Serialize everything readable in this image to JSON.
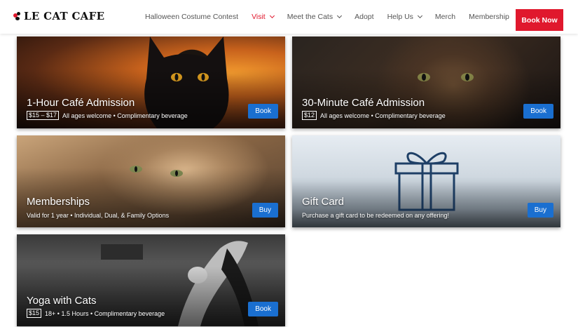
{
  "brand": {
    "name": "LE CAT CAFE",
    "accent": "#e0182d",
    "button_blue": "#1a6fd0"
  },
  "nav": {
    "items": [
      {
        "label": "Halloween Costume Contest",
        "dropdown": false,
        "active": false
      },
      {
        "label": "Visit",
        "dropdown": true,
        "active": true
      },
      {
        "label": "Meet the Cats",
        "dropdown": true,
        "active": false
      },
      {
        "label": "Adopt",
        "dropdown": false,
        "active": false
      },
      {
        "label": "Help Us",
        "dropdown": true,
        "active": false
      },
      {
        "label": "Merch",
        "dropdown": false,
        "active": false
      },
      {
        "label": "Membership",
        "dropdown": false,
        "active": false
      }
    ],
    "cta": "Book Now"
  },
  "cards": [
    {
      "title": "1-Hour Café Admission",
      "price": "$15 – $17",
      "subtitle": "All ages welcome • Complimentary beverage",
      "button": "Book",
      "image": "black-cat-photo"
    },
    {
      "title": "30-Minute Café Admission",
      "price": "$12",
      "subtitle": "All ages welcome • Complimentary beverage",
      "button": "Book",
      "image": "tabby-cat-photo"
    },
    {
      "title": "Memberships",
      "price": "",
      "subtitle": "Valid for 1 year • Individual, Dual, & Family Options",
      "button": "Buy",
      "image": "lounging-cat-photo"
    },
    {
      "title": "Gift Card",
      "price": "",
      "subtitle": "Purchase a gift card to be redeemed on any offering!",
      "button": "Buy",
      "image": "gift-box-icon"
    },
    {
      "title": "Yoga with Cats",
      "price": "$15",
      "subtitle": "18+ • 1.5 Hours • Complimentary beverage",
      "button": "Book",
      "image": "yoga-photo"
    }
  ]
}
